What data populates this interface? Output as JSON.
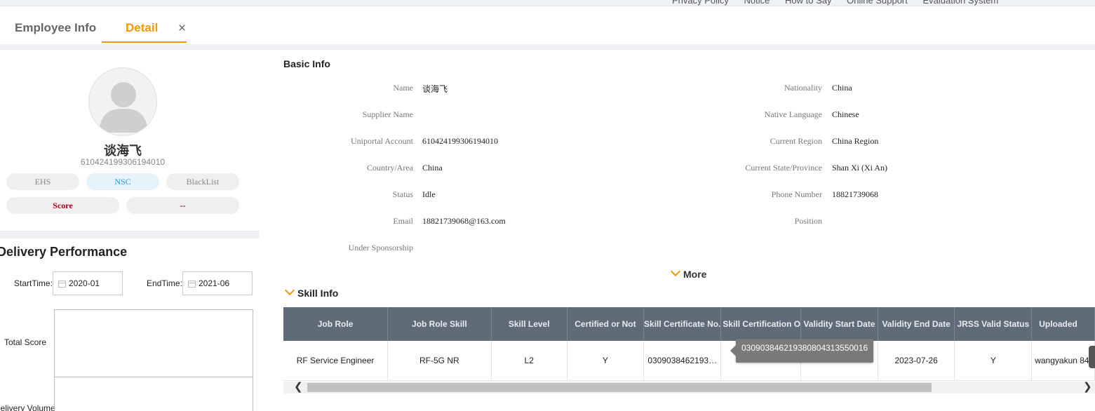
{
  "topbar": {
    "links": [
      "Privacy Policy",
      "Notice",
      "How to Say",
      "Online Support",
      "Evaluation System"
    ]
  },
  "tabs": [
    {
      "label": "Employee Info",
      "active": false
    },
    {
      "label": "Detail",
      "active": true
    }
  ],
  "tab_close": "×",
  "colors": {
    "accent": "#f39800",
    "table_header": "#5f6b77",
    "nsc": "#1a9bd7",
    "score": "#a8001b"
  },
  "profile": {
    "name": "谈海飞",
    "id": "610424199306194010",
    "badges": [
      "EHS",
      "NSC",
      "BlackList"
    ],
    "score_label": "Score",
    "score_value": "--"
  },
  "performance": {
    "title": "Delivery Performance",
    "start_label": "StartTime:",
    "start_value": "2020-01",
    "end_label": "EndTime:",
    "end_value": "2021-06",
    "total_score_label": "Total Score",
    "delivery_volume_label": "Delivery Volume"
  },
  "basic_info": {
    "title": "Basic Info",
    "left": [
      {
        "label": "Name",
        "value": "谈海飞"
      },
      {
        "label": "Supplier Name",
        "value": ""
      },
      {
        "label": "Uniportal Account",
        "value": "610424199306194010"
      },
      {
        "label": "Country/Area",
        "value": "China"
      },
      {
        "label": "Status",
        "value": "Idle"
      },
      {
        "label": "Email",
        "value": "18821739068@163.com"
      },
      {
        "label": "Under Sponsorship",
        "value": ""
      }
    ],
    "right": [
      {
        "label": "Nationality",
        "value": "China"
      },
      {
        "label": "Native Language",
        "value": "Chinese"
      },
      {
        "label": "Current Region",
        "value": "China Region"
      },
      {
        "label": "Current State/Province",
        "value": "Shan Xi (Xi An)"
      },
      {
        "label": "Phone Number",
        "value": "18821739068"
      },
      {
        "label": "Position",
        "value": ""
      }
    ],
    "more_label": "More"
  },
  "skill_info": {
    "title": "Skill Info",
    "columns": [
      "Job Role",
      "Job Role Skill",
      "Skill Level",
      "Certified or Not",
      "Skill Certificate No.",
      "Skill Certification O",
      "Validity Start Date",
      "Validity End Date",
      "JRSS Valid Status",
      "Uploaded"
    ],
    "rows": [
      [
        "RF Service Engineer",
        "RF-5G NR",
        "L2",
        "Y",
        "0309038462193…",
        "",
        "",
        "2023-07-26",
        "Y",
        "wangyakun 84"
      ]
    ],
    "tooltip": "03090384621938080431355001​6"
  }
}
